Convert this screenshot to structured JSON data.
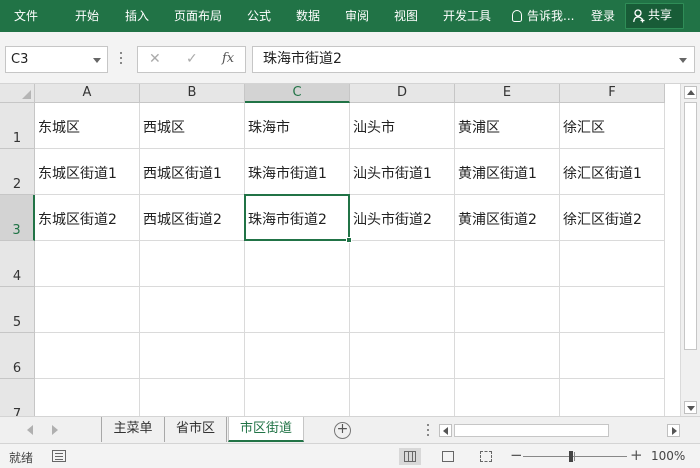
{
  "ribbon": {
    "tabs": [
      "文件",
      "开始",
      "插入",
      "页面布局",
      "公式",
      "数据",
      "审阅",
      "视图",
      "开发工具"
    ],
    "tell_me": "告诉我...",
    "login": "登录",
    "share": "共享"
  },
  "formula_bar": {
    "name_box": "C3",
    "fx": "fx",
    "cancel": "✕",
    "confirm": "✓",
    "content": "珠海市街道2"
  },
  "grid": {
    "columns": [
      "A",
      "B",
      "C",
      "D",
      "E",
      "F"
    ],
    "rows": [
      "1",
      "2",
      "3",
      "4",
      "5",
      "6",
      "7"
    ],
    "selected_cell": "C3",
    "cells": [
      [
        "东城区",
        "西城区",
        "珠海市",
        "汕头市",
        "黄浦区",
        "徐汇区"
      ],
      [
        "东城区街道1",
        "西城区街道1",
        "珠海市街道1",
        "汕头市街道1",
        "黄浦区街道1",
        "徐汇区街道1"
      ],
      [
        "东城区街道2",
        "西城区街道2",
        "珠海市街道2",
        "汕头市街道2",
        "黄浦区街道2",
        "徐汇区街道2"
      ],
      [
        "",
        "",
        "",
        "",
        "",
        ""
      ],
      [
        "",
        "",
        "",
        "",
        "",
        ""
      ],
      [
        "",
        "",
        "",
        "",
        "",
        ""
      ],
      [
        "",
        "",
        "",
        "",
        "",
        ""
      ]
    ]
  },
  "sheets": {
    "tabs": [
      "主菜单",
      "省市区",
      "市区街道"
    ],
    "active": "市区街道",
    "add": "+"
  },
  "status": {
    "ready": "就绪",
    "zoom_minus": "−",
    "zoom_plus": "+",
    "zoom": "100%"
  },
  "colors": {
    "accent": "#217346"
  }
}
